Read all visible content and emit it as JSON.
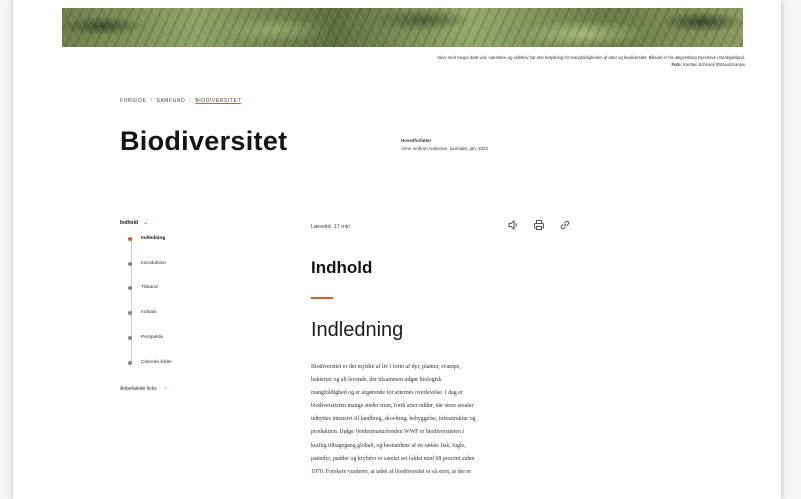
{
  "caption": {
    "text": "Skov med meget dødt ved, naturskov og vildskov har stor betydning for mangfoldigheden af arter og biodiversitet. Billedet er fra Jægersborg Dyrehave i Nordsjælland.",
    "photo_label": "Foto:",
    "photo_credit": "Karsten Schnack /Ritzau/Scanpix"
  },
  "breadcrumb": [
    "FORSIDE",
    "SAMFUND",
    "BIODIVERSITET"
  ],
  "page_title": "Biodiversitet",
  "author": {
    "label": "Hovedforfatter",
    "value": "Anne Ambrun Andersen, journalist, jan. 2023"
  },
  "toc": {
    "heading": "Indhold",
    "items": [
      "Indledning",
      "Introduktion",
      "Tilstand",
      "Indsats",
      "Perspektiv",
      "Citerede kilder"
    ],
    "links_label": "Anbefalede links"
  },
  "reading_time": "Læsetid: 17 min",
  "tools": {
    "listen_icon": "speaker-icon",
    "print_icon": "print-icon",
    "link_icon": "link-icon"
  },
  "content": {
    "heading": "Indhold",
    "section_heading": "Indledning",
    "lines": [
      "Biodiversitet er det myldre af liv i form af dyr, planter, svampe,",
      "bakterier og alt levende, der tilsammen udgør biologisk",
      "mangfoldighed og er afgørende for arternes overlevelse. I dag er",
      "biodiversiteten mange steder truet, fordi arter uddør, når store arealer",
      "udnyttes intensivt til landbrug, skovbrug, bebyggelse, infrastruktur og",
      "produktion. Ifølge Verdensnaturfonden WWF er biodiversiteten i",
      "kraftig tilbagegang globalt, og bestandene af en række fisk, fugle,",
      "pattedyr, padder og krybdyr er samlet set faldet med 68 procent siden",
      "1970. Forskere vurderer, at tabet af biodiversitet er så stort, at der er"
    ]
  },
  "colors": {
    "accent": "#d65a37",
    "text": "#1a1a1a",
    "muted": "#888888"
  }
}
